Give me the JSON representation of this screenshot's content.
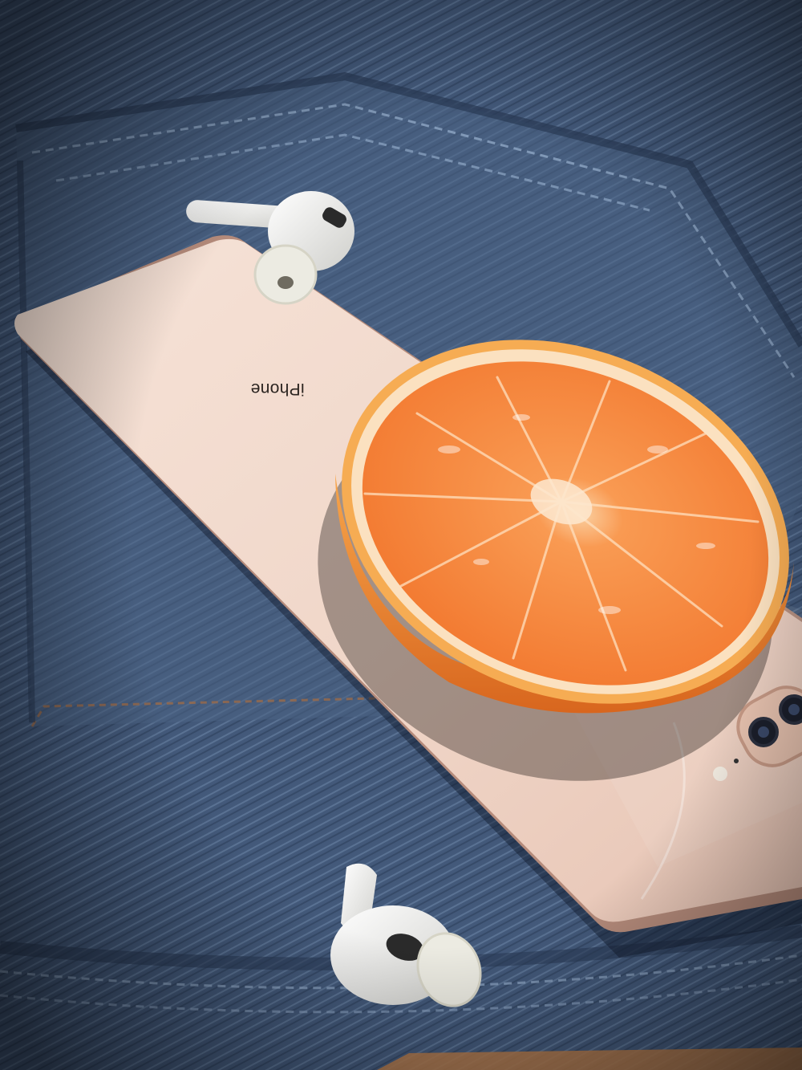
{
  "phone": {
    "brand_text": "iPhone"
  },
  "colors": {
    "denim_dark": "#2f4461",
    "denim_mid": "#4f6a8f",
    "denim_light": "#7d95b4",
    "stitch": "#9a6a4a",
    "phone_body": "#f2d9cc",
    "phone_edge": "#b98f80",
    "orange_rind": "#f2b25a",
    "orange_pith": "#fbe2c2",
    "orange_flesh": "#f7833a",
    "earbud_white": "#f1f1ee"
  },
  "icons": {
    "earbud_top": "earbud-icon",
    "earbud_bottom": "earbud-icon",
    "camera": "camera-lens-icon"
  }
}
